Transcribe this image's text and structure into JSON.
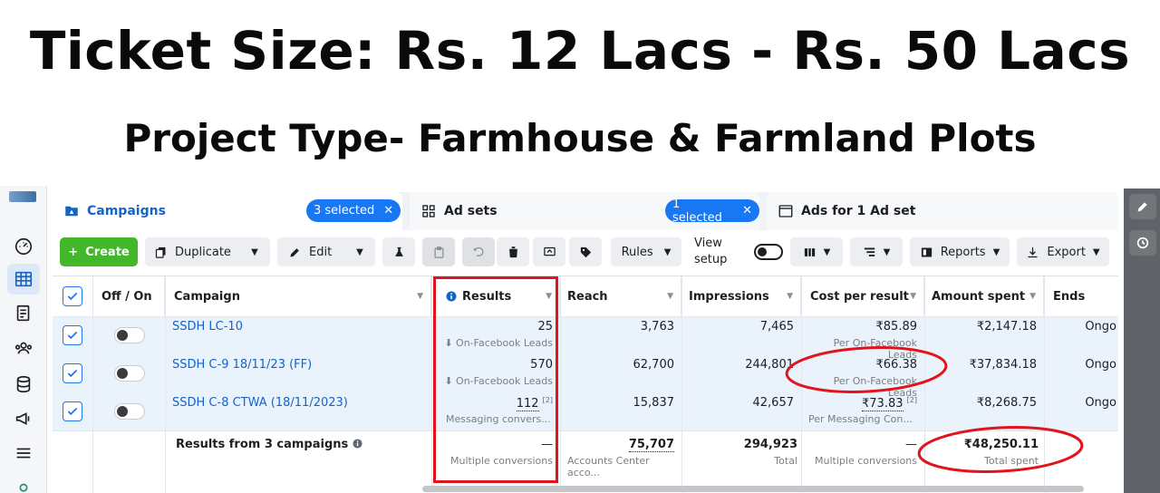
{
  "headline": {
    "title": "Ticket Size: Rs. 12 Lacs - Rs. 50 Lacs",
    "subtitle": "Project Type- Farmhouse & Farmland Plots"
  },
  "colors": {
    "accent": "#1877f2",
    "create": "#42b72a",
    "highlight_red": "#e0141b",
    "selected_row": "#eaf2fc"
  },
  "tabs": {
    "campaigns": {
      "label": "Campaigns",
      "badge": "3 selected",
      "icon": "campaign-folder-icon"
    },
    "adsets": {
      "label": "Ad sets",
      "badge": "1 selected",
      "icon": "grid-icon"
    },
    "ads": {
      "label": "Ads for 1 Ad set",
      "icon": "ad-card-icon"
    }
  },
  "toolbar": {
    "create": "Create",
    "duplicate": "Duplicate",
    "edit": "Edit",
    "rules": "Rules",
    "view_setup_1": "View",
    "view_setup_2": "setup",
    "reports": "Reports",
    "export": "Export"
  },
  "table": {
    "headers": {
      "off_on": "Off / On",
      "campaign": "Campaign",
      "results": "Results",
      "reach": "Reach",
      "impressions": "Impressions",
      "cost_per_result": "Cost per result",
      "amount_spent": "Amount spent",
      "ends": "Ends"
    },
    "rows": [
      {
        "name": "SSDH LC-10",
        "results": "25",
        "results_sub": "On-Facebook Leads",
        "reach": "3,763",
        "impressions": "7,465",
        "cpr": "₹85.89",
        "cpr_sub": "Per On-Facebook Leads",
        "spent": "₹2,147.18",
        "ends": "Ongo",
        "checked": true
      },
      {
        "name": "SSDH C-9 18/11/23 (FF)",
        "results": "570",
        "results_sub": "On-Facebook Leads",
        "reach": "62,700",
        "impressions": "244,801",
        "cpr": "₹66.38",
        "cpr_sub": "Per On-Facebook Leads",
        "spent": "₹37,834.18",
        "ends": "Ongo",
        "checked": true
      },
      {
        "name": "SSDH C-8 CTWA (18/11/2023)",
        "results": "112",
        "results_sup": "[2]",
        "results_sub": "Messaging convers...",
        "reach": "15,837",
        "impressions": "42,657",
        "cpr": "₹73.83",
        "cpr_sup": "[2]",
        "cpr_sub": "Per Messaging Con...",
        "spent": "₹8,268.75",
        "ends": "Ongo",
        "checked": true
      }
    ],
    "totals": {
      "label": "Results from 3 campaigns",
      "results": "—",
      "results_sub": "Multiple conversions",
      "reach": "75,707",
      "reach_sub": "Accounts Center acco...",
      "impressions": "294,923",
      "impressions_sub": "Total",
      "cpr": "—",
      "cpr_sub": "Multiple conversions",
      "spent": "₹48,250.11",
      "spent_sub": "Total spent"
    }
  }
}
